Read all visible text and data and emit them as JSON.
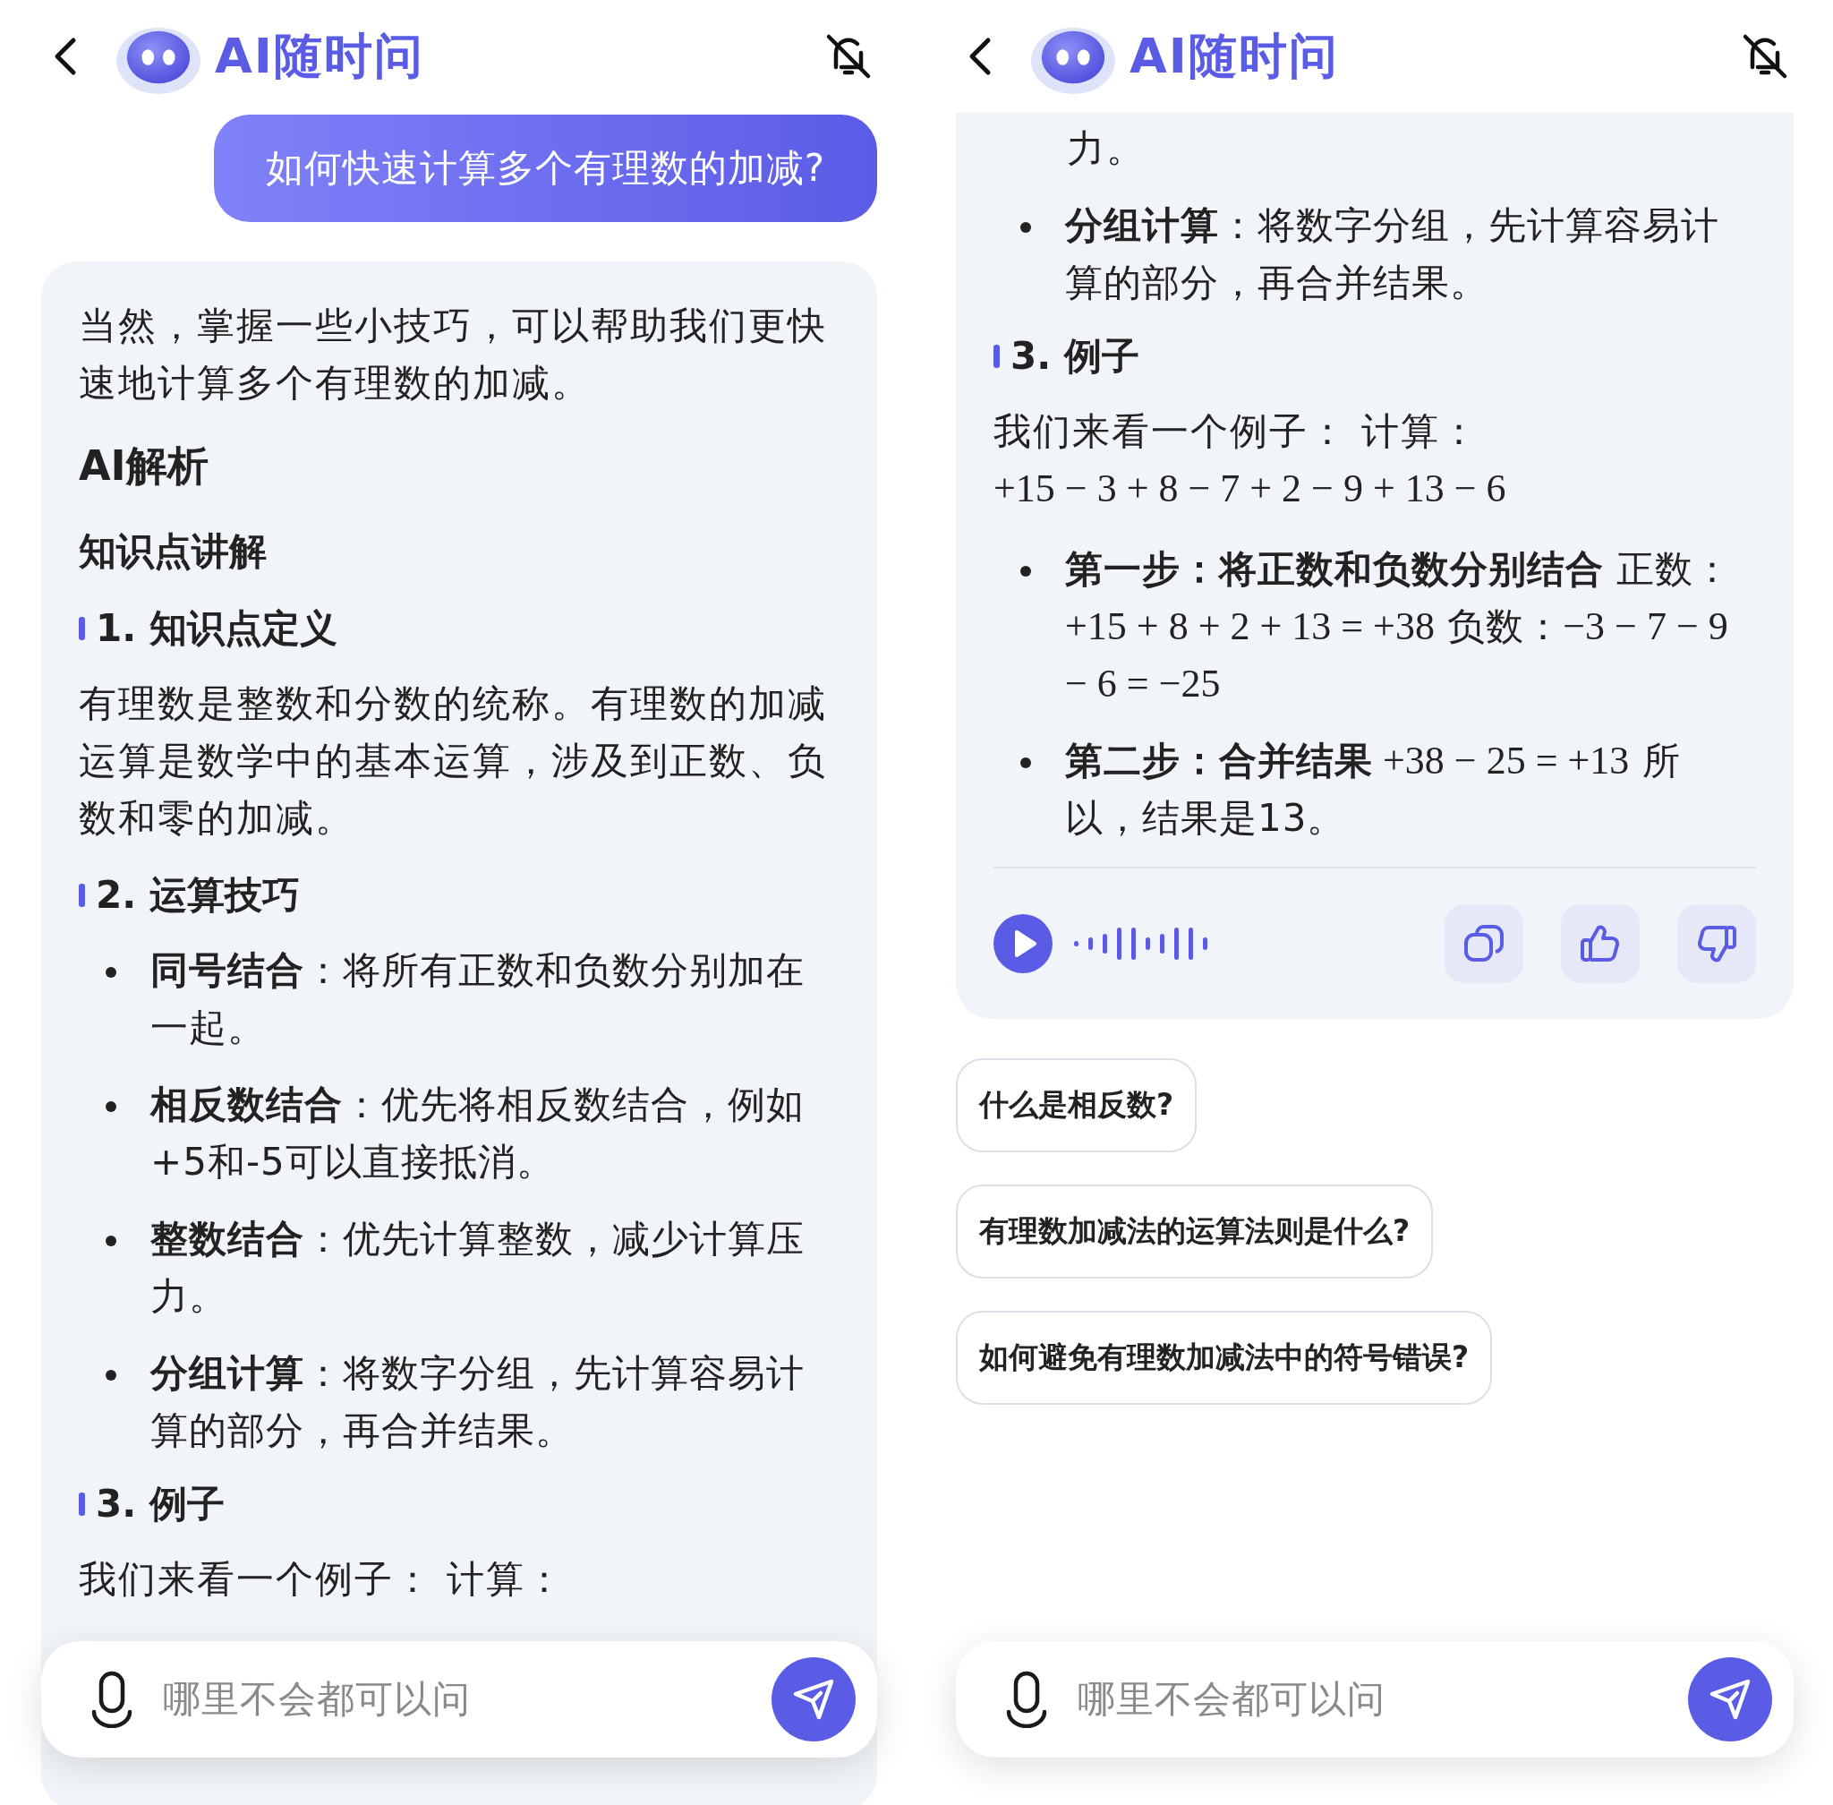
{
  "screens": [
    {
      "header": {
        "title": "AI随时问"
      },
      "user_message": "如何快速计算多个有理数的加减?",
      "answer": {
        "top_cut": false,
        "blocks": [
          {
            "kind": "text",
            "text": "当然，掌握一些小技巧，可以帮助我们更快速地计算多个有理数的加减。"
          },
          {
            "kind": "title",
            "text": "AI解析"
          },
          {
            "kind": "subtitle",
            "text": "知识点讲解"
          },
          {
            "kind": "section",
            "text": "1. 知识点定义"
          },
          {
            "kind": "text",
            "text": "有理数是整数和分数的统称。有理数的加减运算是数学中的基本运算，涉及到正数、负数和零的加减。"
          },
          {
            "kind": "section",
            "text": "2. 运算技巧"
          },
          {
            "kind": "bullets",
            "items": [
              {
                "parts": [
                  {
                    "kind": "bold",
                    "text": "同号结合"
                  },
                  {
                    "kind": "plain",
                    "text": "：将所有正数和负数分别加在一起。"
                  }
                ]
              },
              {
                "parts": [
                  {
                    "kind": "bold",
                    "text": "相反数结合"
                  },
                  {
                    "kind": "plain",
                    "text": "：优先将相反数结合，例如+5和-5可以直接抵消。"
                  }
                ]
              },
              {
                "parts": [
                  {
                    "kind": "bold",
                    "text": "整数结合"
                  },
                  {
                    "kind": "plain",
                    "text": "：优先计算整数，减少计算压力。"
                  }
                ]
              },
              {
                "parts": [
                  {
                    "kind": "bold",
                    "text": "分组计算"
                  },
                  {
                    "kind": "plain",
                    "text": "：将数字分组，先计算容易计算的部分，再合并结果。"
                  }
                ]
              }
            ]
          },
          {
            "kind": "section",
            "text": "3. 例子"
          },
          {
            "kind": "text",
            "text": "我们来看一个例子： 计算："
          }
        ]
      },
      "input": {
        "placeholder": "哪里不会都可以问"
      }
    },
    {
      "header": {
        "title": "AI随时问"
      },
      "answer": {
        "top_cut": true,
        "blocks": [
          {
            "kind": "tail",
            "text": "力。"
          },
          {
            "kind": "bullets",
            "items": [
              {
                "parts": [
                  {
                    "kind": "bold",
                    "text": "分组计算"
                  },
                  {
                    "kind": "plain",
                    "text": "：将数字分组，先计算容易计算的部分，再合并结果。"
                  }
                ]
              }
            ]
          },
          {
            "kind": "section",
            "text": "3. 例子"
          },
          {
            "kind": "text",
            "parts": [
              {
                "kind": "plain",
                "text": "我们来看一个例子： 计算："
              },
              {
                "kind": "display",
                "text": "+15 − 3 + 8 − 7 + 2 − 9 + 13 − 6"
              }
            ]
          },
          {
            "kind": "bullets",
            "items": [
              {
                "parts": [
                  {
                    "kind": "bold",
                    "text": "第一步：将正数和负数分别结合"
                  },
                  {
                    "kind": "plain",
                    "text": " 正数："
                  },
                  {
                    "kind": "math",
                    "text": "+15 + 8 + 2 + 13 = +38"
                  },
                  {
                    "kind": "plain",
                    "text": " 负数："
                  },
                  {
                    "kind": "math",
                    "text": "−3 − 7 − 9 − 6 = −25"
                  }
                ]
              },
              {
                "parts": [
                  {
                    "kind": "bold",
                    "text": "第二步：合并结果"
                  },
                  {
                    "kind": "math",
                    "text": " +38 − 25 = +13"
                  },
                  {
                    "kind": "plain",
                    "text": " 所以，结果是13。"
                  }
                ]
              }
            ]
          },
          {
            "kind": "toolbar"
          }
        ]
      },
      "suggestions": [
        "什么是相反数?",
        "有理数加减法的运算法则是什么?",
        "如何避免有理数加减法中的符号错误?"
      ],
      "input": {
        "placeholder": "哪里不会都可以问"
      }
    }
  ]
}
